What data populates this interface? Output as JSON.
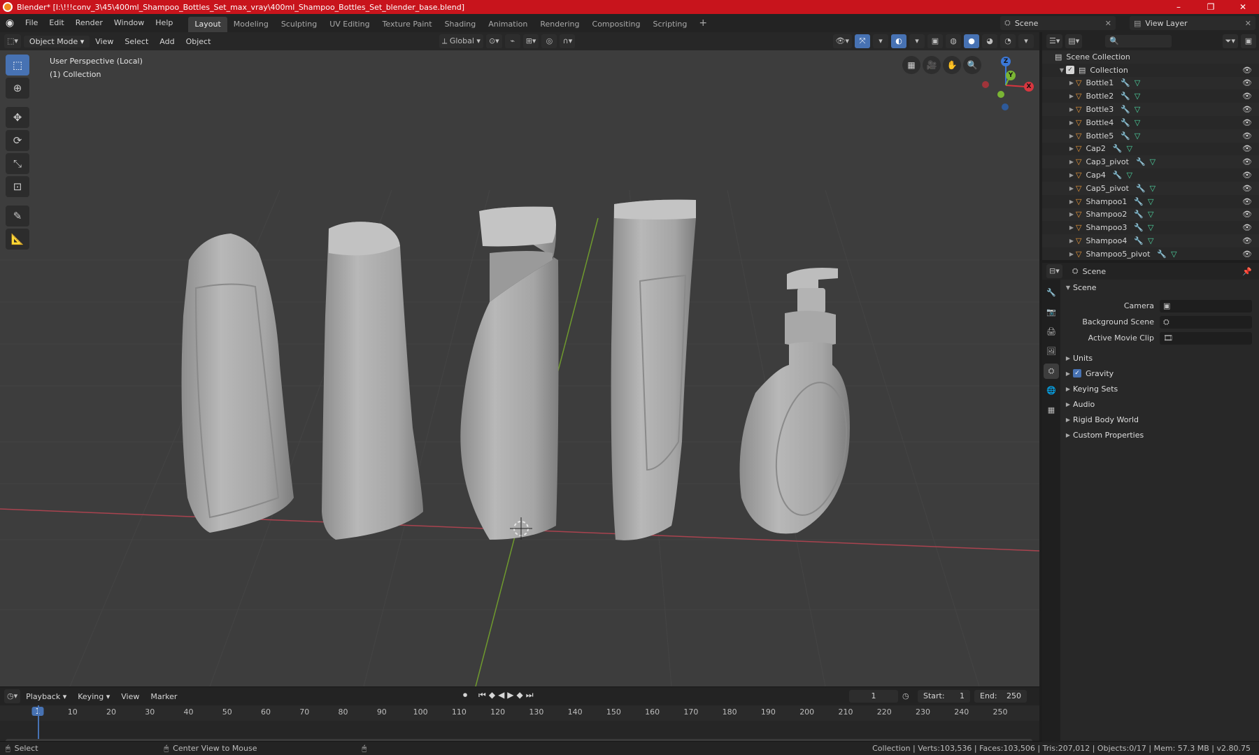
{
  "title_bar": {
    "title": "Blender* [I:\\!!!conv_3\\45\\400ml_Shampoo_Bottles_Set_max_vray\\400ml_Shampoo_Bottles_Set_blender_base.blend]",
    "min": "–",
    "max": "❐",
    "close": "✕"
  },
  "menu": {
    "items": [
      "File",
      "Edit",
      "Render",
      "Window",
      "Help"
    ]
  },
  "workspaces": [
    "Layout",
    "Modeling",
    "Sculpting",
    "UV Editing",
    "Texture Paint",
    "Shading",
    "Animation",
    "Rendering",
    "Compositing",
    "Scripting"
  ],
  "workspace_add": "+",
  "scene_field": "Scene",
  "view_layer_field": "View Layer",
  "viewport": {
    "mode": "Object Mode",
    "menus": [
      "View",
      "Select",
      "Add",
      "Object"
    ],
    "transform_orientation": "Global",
    "info_line1": "User Perspective (Local)",
    "info_line2": "(1) Collection",
    "gizmo": {
      "z": "Z",
      "y": "Y",
      "x": "X"
    }
  },
  "timeline": {
    "menus": [
      "Playback",
      "Keying",
      "View",
      "Marker"
    ],
    "current_frame": "1",
    "start_label": "Start:",
    "start": "1",
    "end_label": "End:",
    "end": "250",
    "ticks": [
      "1",
      "10",
      "20",
      "30",
      "40",
      "50",
      "60",
      "70",
      "80",
      "90",
      "100",
      "110",
      "120",
      "130",
      "140",
      "150",
      "160",
      "170",
      "180",
      "190",
      "200",
      "210",
      "220",
      "230",
      "240",
      "250"
    ]
  },
  "status_bar": {
    "left": "Select",
    "middle": "Center View to Mouse",
    "stats": "Collection | Verts:103,536 | Faces:103,506 | Tris:207,012 | Objects:0/17 | Mem: 57.3 MB | v2.80.75"
  },
  "outliner": {
    "scene_collection": "Scene Collection",
    "collection": "Collection",
    "objects": [
      "Bottle1",
      "Bottle2",
      "Bottle3",
      "Bottle4",
      "Bottle5",
      "Cap2",
      "Cap3_pivot",
      "Cap4",
      "Cap5_pivot",
      "Shampoo1",
      "Shampoo2",
      "Shampoo3",
      "Shampoo4",
      "Shampoo5_pivot"
    ]
  },
  "properties": {
    "header": "Scene",
    "panel": "Scene",
    "camera_label": "Camera",
    "background_label": "Background Scene",
    "movieclip_label": "Active Movie Clip",
    "subpanels": [
      "Units",
      "Gravity",
      "Keying Sets",
      "Audio",
      "Rigid Body World",
      "Custom Properties"
    ]
  },
  "colors": {
    "accent": "#4772b3",
    "titlebar": "#c8141c",
    "object_icon": "#e8973a",
    "mesh_icon": "#4ed4a0"
  }
}
